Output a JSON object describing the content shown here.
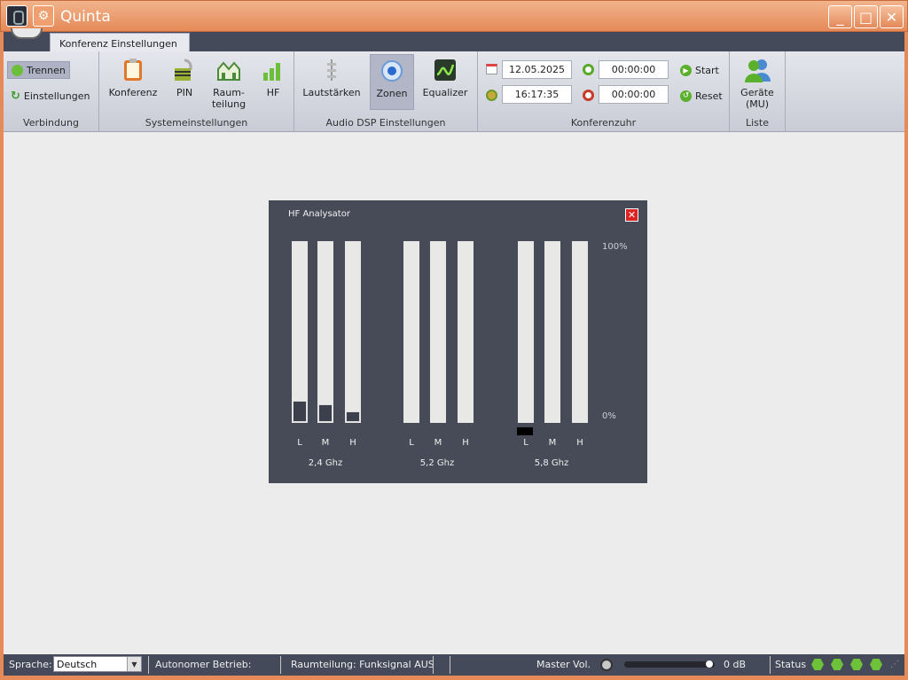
{
  "window": {
    "title": "Quinta",
    "min_symbol": "_",
    "max_symbol": "□",
    "close_symbol": "✕"
  },
  "tabs": [
    {
      "label": "Konferenz Einstellungen",
      "active": true
    }
  ],
  "ribbon": {
    "verbindung": {
      "label": "Verbindung",
      "trennen": "Trennen",
      "einstellungen": "Einstellungen"
    },
    "systemeinstellungen": {
      "label": "Systemeinstellungen",
      "konferenz": "Konferenz",
      "pin": "PIN",
      "raumteilung_1": "Raum-",
      "raumteilung_2": "teilung",
      "hf": "HF"
    },
    "audio_dsp": {
      "label": "Audio DSP Einstellungen",
      "lautstaerken": "Lautstärken",
      "zonen": "Zonen",
      "equalizer": "Equalizer"
    },
    "konferenzuhr": {
      "label": "Konferenzuhr",
      "date": "12.05.2025",
      "time": "16:17:35",
      "timer1": "00:00:00",
      "timer2": "00:00:00",
      "start": "Start",
      "reset": "Reset"
    },
    "liste": {
      "label": "Liste",
      "geraete_1": "Geräte",
      "geraete_2": "(MU)"
    }
  },
  "hf_dialog": {
    "title": "HF Analysator",
    "close": "✕",
    "pct_top": "100%",
    "pct_bottom": "0%",
    "bands": [
      {
        "name": "2,4 Ghz",
        "channels": [
          {
            "label": "L",
            "level": 0.12
          },
          {
            "label": "M",
            "level": 0.1
          },
          {
            "label": "H",
            "level": 0.06
          }
        ]
      },
      {
        "name": "5,2 Ghz",
        "channels": [
          {
            "label": "L",
            "level": 0
          },
          {
            "label": "M",
            "level": 0
          },
          {
            "label": "H",
            "level": 0
          }
        ]
      },
      {
        "name": "5,8 Ghz",
        "channels": [
          {
            "label": "L",
            "level": 0
          },
          {
            "label": "M",
            "level": 0
          },
          {
            "label": "H",
            "level": 0
          }
        ]
      }
    ]
  },
  "statusbar": {
    "sprache_label": "Sprache:",
    "sprache_value": "Deutsch",
    "autonom": "Autonomer Betrieb:",
    "raumteilung": "Raumteilung: Funksignal AUS",
    "master_vol_label": "Master Vol.",
    "master_vol_value": "0 dB",
    "master_vol_level": 0.98,
    "status_label": "Status"
  },
  "colors": {
    "title_bar": "#e58a58",
    "status_ok": "#6dc23a",
    "dialog_bg": "#474a57"
  }
}
